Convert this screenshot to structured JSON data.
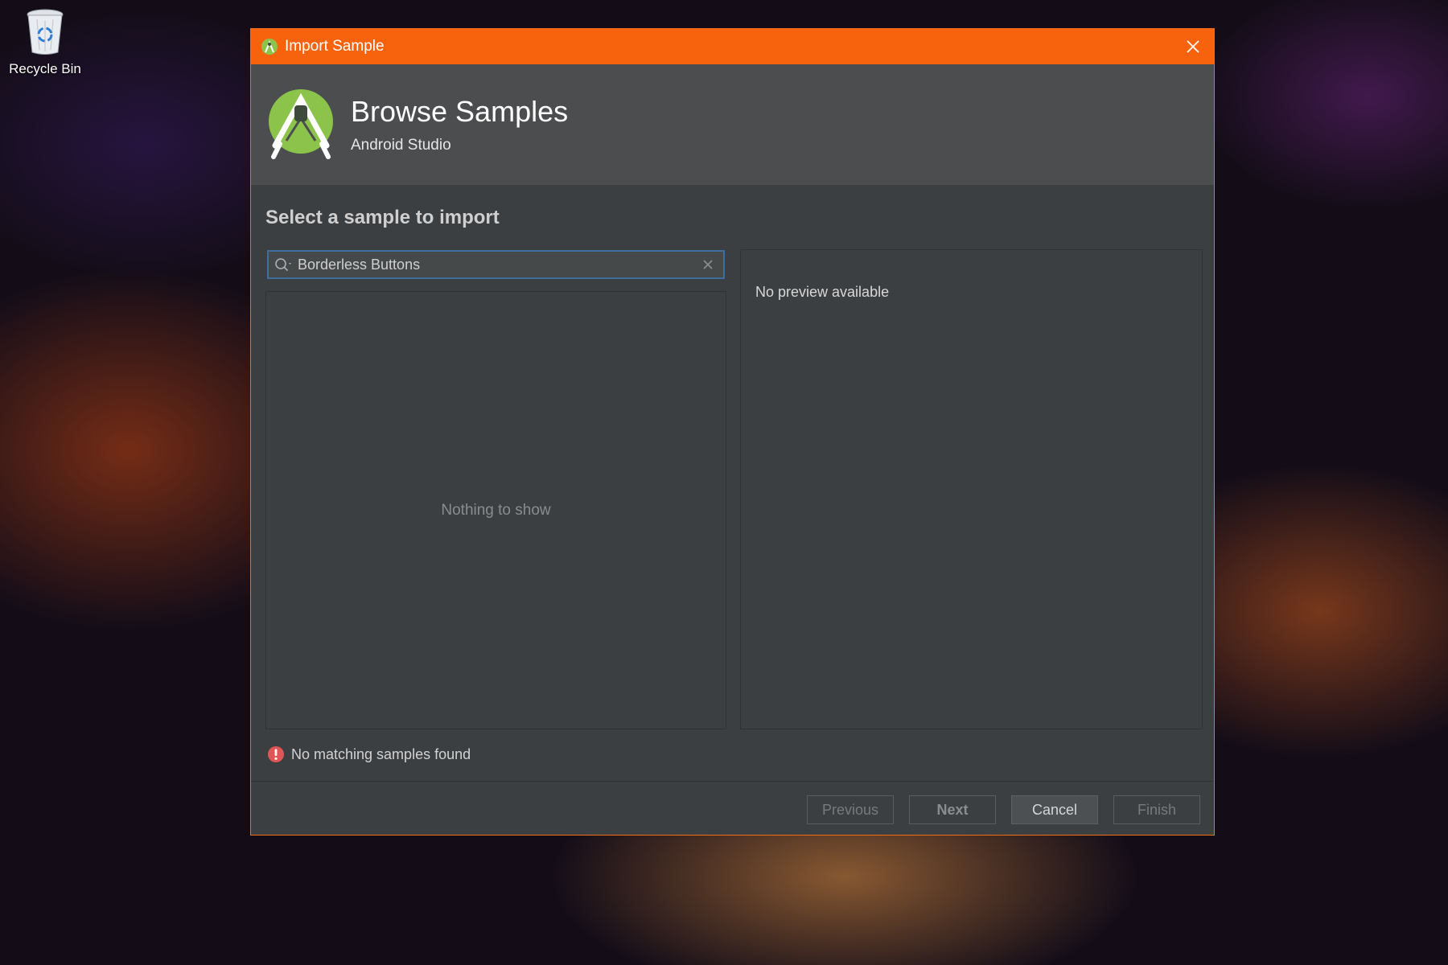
{
  "desktop": {
    "recycle_bin_label": "Recycle Bin"
  },
  "window": {
    "title": "Import Sample",
    "accent": "#f7630c"
  },
  "header": {
    "title": "Browse Samples",
    "subtitle": "Android Studio"
  },
  "main": {
    "section_title": "Select a sample to import",
    "search": {
      "value": "Borderless Buttons",
      "placeholder": ""
    },
    "list_empty_text": "Nothing to show",
    "preview_text": "No preview available",
    "error_text": "No matching samples found"
  },
  "footer": {
    "previous_label": "Previous",
    "next_label": "Next",
    "cancel_label": "Cancel",
    "finish_label": "Finish"
  }
}
